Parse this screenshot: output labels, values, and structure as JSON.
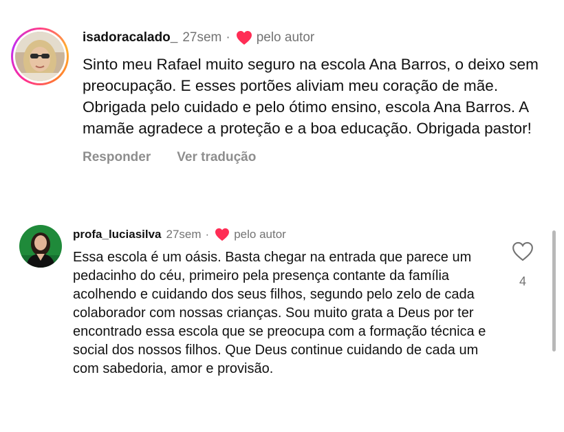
{
  "comments": [
    {
      "username": "isadoracalado_",
      "time": "27sem",
      "separator": "·",
      "liked_by_author": "pelo autor",
      "text": "Sinto meu Rafael muito seguro na escola Ana Barros, o deixo sem preocupação. E esses portões aliviam meu coração de mãe. Obrigada pelo cuidado e pelo ótimo ensino, escola Ana Barros. A mamãe agradece a proteção e a boa educação. Obrigada pastor!",
      "reply_label": "Responder",
      "translate_label": "Ver tradução"
    },
    {
      "username": "profa_luciasilva",
      "time": "27sem",
      "separator": "·",
      "liked_by_author": "pelo autor",
      "text": "Essa escola é um oásis. Basta chegar na entrada que parece um pedacinho do céu, primeiro pela presença contante da família acolhendo e cuidando dos seus filhos, segundo pelo zelo de cada colaborador com nossas crianças. Sou muito grata a Deus por ter encontrado essa escola que se preocupa com a formação técnica e social dos nossos filhos. Que Deus continue cuidando de cada um com sabedoria, amor e provisão.",
      "like_count": "4"
    }
  ],
  "icons": {
    "author_heart": "heart-filled-icon",
    "like": "heart-outline-icon"
  },
  "colors": {
    "author_heart": "#ff2d55",
    "meta_gray": "#737373",
    "action_gray": "#8e8e8e"
  }
}
